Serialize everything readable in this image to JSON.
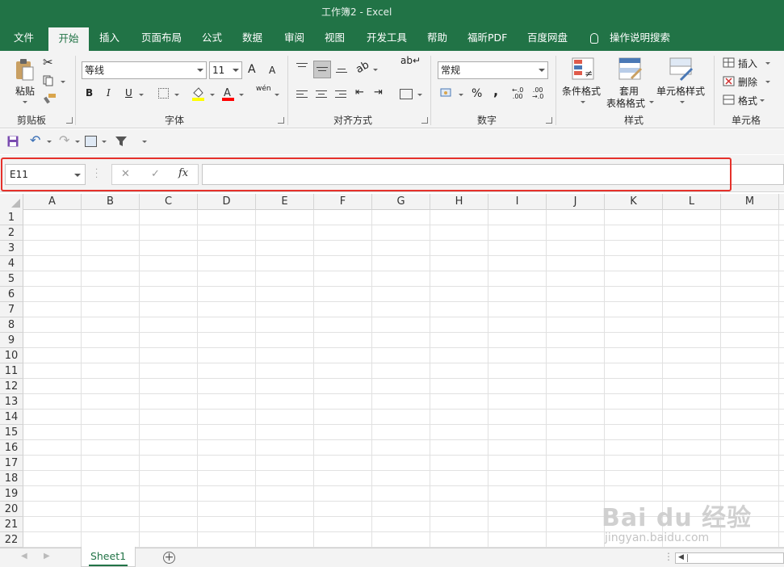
{
  "window": {
    "title": "工作簿2  -  Excel"
  },
  "tabs": [
    "文件",
    "开始",
    "插入",
    "页面布局",
    "公式",
    "数据",
    "审阅",
    "视图",
    "开发工具",
    "帮助",
    "福昕PDF",
    "百度网盘",
    "操作说明搜索"
  ],
  "active_tab": "开始",
  "ribbon": {
    "clipboard": {
      "paste": "粘贴",
      "label": "剪贴板"
    },
    "font": {
      "name": "等线",
      "size": "11",
      "bold": "B",
      "italic": "I",
      "underline": "U",
      "grow": "A",
      "shrink": "A",
      "phonetic": "wén",
      "label": "字体"
    },
    "alignment": {
      "label": "对齐方式"
    },
    "number": {
      "format": "常规",
      "percent": "%",
      "comma": ",",
      "label": "数字"
    },
    "styles": {
      "conditional": "条件格式",
      "table_line1": "套用",
      "table_line2": "表格格式",
      "cell_styles": "单元格样式",
      "label": "样式"
    },
    "cells": {
      "insert": "插入",
      "delete": "删除",
      "format": "格式",
      "label": "单元格"
    }
  },
  "formula_bar": {
    "name_box": "E11",
    "cancel": "✕",
    "confirm": "✓",
    "fx": "fx",
    "value": ""
  },
  "columns": [
    "A",
    "B",
    "C",
    "D",
    "E",
    "F",
    "G",
    "H",
    "I",
    "J",
    "K",
    "L",
    "M"
  ],
  "rows": [
    "1",
    "2",
    "3",
    "4",
    "5",
    "6",
    "7",
    "8",
    "9",
    "10",
    "11",
    "12",
    "13",
    "14",
    "15",
    "16",
    "17",
    "18",
    "19",
    "20",
    "21",
    "22"
  ],
  "sheet": {
    "tab": "Sheet1",
    "add": "+"
  },
  "watermark": {
    "line1": "Bai du 经验",
    "line2": "jingyan.baidu.com"
  },
  "colors": {
    "brand_green": "#217346",
    "highlight_red": "#e5312b"
  }
}
